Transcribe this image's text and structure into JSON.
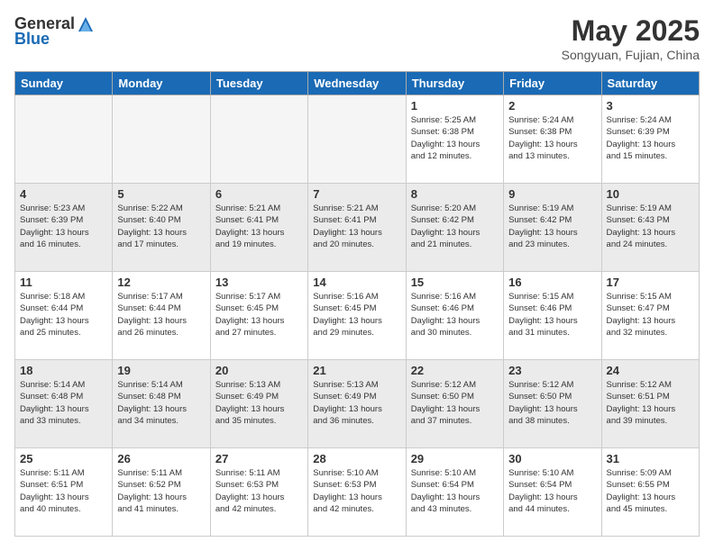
{
  "header": {
    "logo_general": "General",
    "logo_blue": "Blue",
    "month": "May 2025",
    "location": "Songyuan, Fujian, China"
  },
  "days_of_week": [
    "Sunday",
    "Monday",
    "Tuesday",
    "Wednesday",
    "Thursday",
    "Friday",
    "Saturday"
  ],
  "weeks": [
    [
      {
        "day": "",
        "info": "",
        "empty": true
      },
      {
        "day": "",
        "info": "",
        "empty": true
      },
      {
        "day": "",
        "info": "",
        "empty": true
      },
      {
        "day": "",
        "info": "",
        "empty": true
      },
      {
        "day": "1",
        "info": "Sunrise: 5:25 AM\nSunset: 6:38 PM\nDaylight: 13 hours\nand 12 minutes."
      },
      {
        "day": "2",
        "info": "Sunrise: 5:24 AM\nSunset: 6:38 PM\nDaylight: 13 hours\nand 13 minutes."
      },
      {
        "day": "3",
        "info": "Sunrise: 5:24 AM\nSunset: 6:39 PM\nDaylight: 13 hours\nand 15 minutes."
      }
    ],
    [
      {
        "day": "4",
        "info": "Sunrise: 5:23 AM\nSunset: 6:39 PM\nDaylight: 13 hours\nand 16 minutes."
      },
      {
        "day": "5",
        "info": "Sunrise: 5:22 AM\nSunset: 6:40 PM\nDaylight: 13 hours\nand 17 minutes."
      },
      {
        "day": "6",
        "info": "Sunrise: 5:21 AM\nSunset: 6:41 PM\nDaylight: 13 hours\nand 19 minutes."
      },
      {
        "day": "7",
        "info": "Sunrise: 5:21 AM\nSunset: 6:41 PM\nDaylight: 13 hours\nand 20 minutes."
      },
      {
        "day": "8",
        "info": "Sunrise: 5:20 AM\nSunset: 6:42 PM\nDaylight: 13 hours\nand 21 minutes."
      },
      {
        "day": "9",
        "info": "Sunrise: 5:19 AM\nSunset: 6:42 PM\nDaylight: 13 hours\nand 23 minutes."
      },
      {
        "day": "10",
        "info": "Sunrise: 5:19 AM\nSunset: 6:43 PM\nDaylight: 13 hours\nand 24 minutes."
      }
    ],
    [
      {
        "day": "11",
        "info": "Sunrise: 5:18 AM\nSunset: 6:44 PM\nDaylight: 13 hours\nand 25 minutes."
      },
      {
        "day": "12",
        "info": "Sunrise: 5:17 AM\nSunset: 6:44 PM\nDaylight: 13 hours\nand 26 minutes."
      },
      {
        "day": "13",
        "info": "Sunrise: 5:17 AM\nSunset: 6:45 PM\nDaylight: 13 hours\nand 27 minutes."
      },
      {
        "day": "14",
        "info": "Sunrise: 5:16 AM\nSunset: 6:45 PM\nDaylight: 13 hours\nand 29 minutes."
      },
      {
        "day": "15",
        "info": "Sunrise: 5:16 AM\nSunset: 6:46 PM\nDaylight: 13 hours\nand 30 minutes."
      },
      {
        "day": "16",
        "info": "Sunrise: 5:15 AM\nSunset: 6:46 PM\nDaylight: 13 hours\nand 31 minutes."
      },
      {
        "day": "17",
        "info": "Sunrise: 5:15 AM\nSunset: 6:47 PM\nDaylight: 13 hours\nand 32 minutes."
      }
    ],
    [
      {
        "day": "18",
        "info": "Sunrise: 5:14 AM\nSunset: 6:48 PM\nDaylight: 13 hours\nand 33 minutes."
      },
      {
        "day": "19",
        "info": "Sunrise: 5:14 AM\nSunset: 6:48 PM\nDaylight: 13 hours\nand 34 minutes."
      },
      {
        "day": "20",
        "info": "Sunrise: 5:13 AM\nSunset: 6:49 PM\nDaylight: 13 hours\nand 35 minutes."
      },
      {
        "day": "21",
        "info": "Sunrise: 5:13 AM\nSunset: 6:49 PM\nDaylight: 13 hours\nand 36 minutes."
      },
      {
        "day": "22",
        "info": "Sunrise: 5:12 AM\nSunset: 6:50 PM\nDaylight: 13 hours\nand 37 minutes."
      },
      {
        "day": "23",
        "info": "Sunrise: 5:12 AM\nSunset: 6:50 PM\nDaylight: 13 hours\nand 38 minutes."
      },
      {
        "day": "24",
        "info": "Sunrise: 5:12 AM\nSunset: 6:51 PM\nDaylight: 13 hours\nand 39 minutes."
      }
    ],
    [
      {
        "day": "25",
        "info": "Sunrise: 5:11 AM\nSunset: 6:51 PM\nDaylight: 13 hours\nand 40 minutes."
      },
      {
        "day": "26",
        "info": "Sunrise: 5:11 AM\nSunset: 6:52 PM\nDaylight: 13 hours\nand 41 minutes."
      },
      {
        "day": "27",
        "info": "Sunrise: 5:11 AM\nSunset: 6:53 PM\nDaylight: 13 hours\nand 42 minutes."
      },
      {
        "day": "28",
        "info": "Sunrise: 5:10 AM\nSunset: 6:53 PM\nDaylight: 13 hours\nand 42 minutes."
      },
      {
        "day": "29",
        "info": "Sunrise: 5:10 AM\nSunset: 6:54 PM\nDaylight: 13 hours\nand 43 minutes."
      },
      {
        "day": "30",
        "info": "Sunrise: 5:10 AM\nSunset: 6:54 PM\nDaylight: 13 hours\nand 44 minutes."
      },
      {
        "day": "31",
        "info": "Sunrise: 5:09 AM\nSunset: 6:55 PM\nDaylight: 13 hours\nand 45 minutes."
      }
    ]
  ]
}
